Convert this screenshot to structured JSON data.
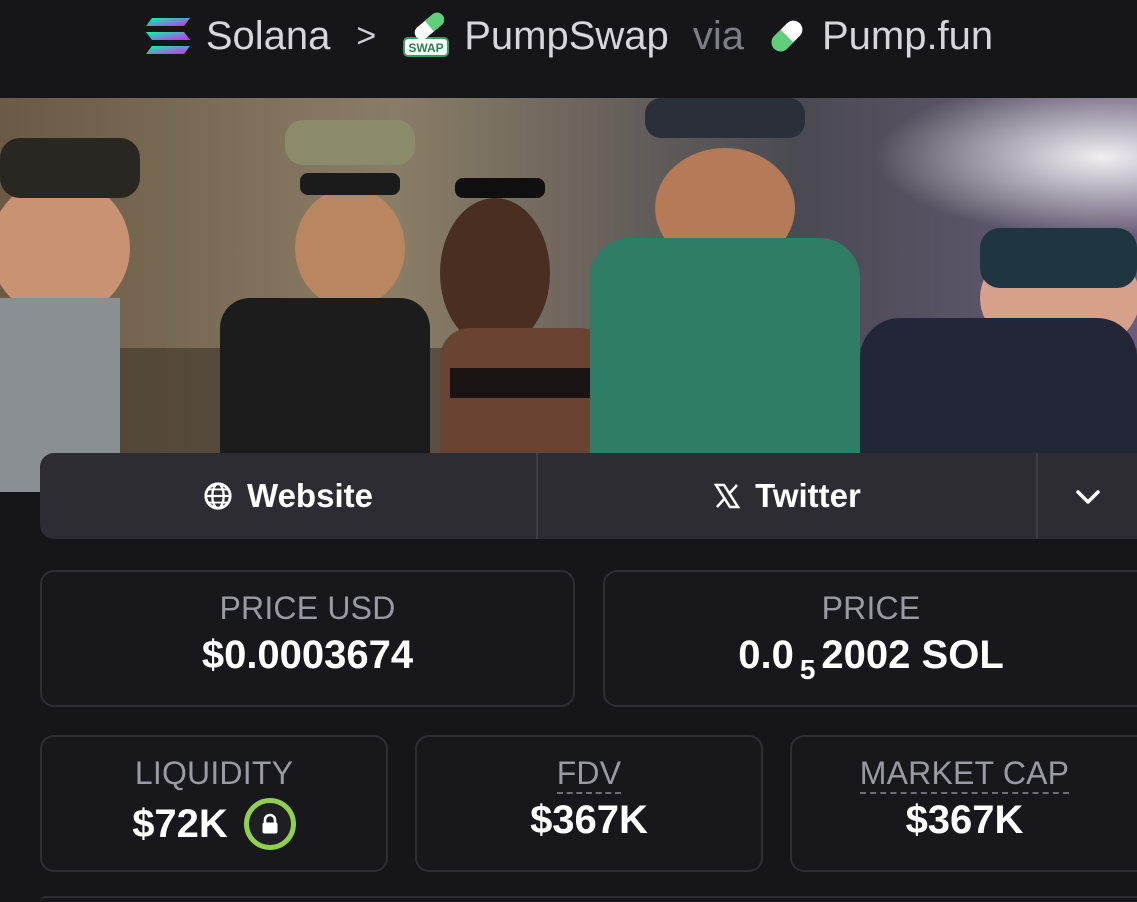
{
  "breadcrumb": {
    "chain": "Solana",
    "separator": ">",
    "dex": "PumpSwap",
    "dex_badge": "SWAP",
    "via": "via",
    "source": "Pump.fun",
    "icons": [
      "solana-icon",
      "chevron-right-icon",
      "pumpswap-icon",
      "pill-icon"
    ]
  },
  "banner": {
    "alt": "token banner image"
  },
  "links": {
    "website_label": "Website",
    "twitter_label": "Twitter",
    "icons": [
      "globe-icon",
      "x-icon",
      "chevron-down-icon"
    ]
  },
  "stats": {
    "price_usd": {
      "label": "PRICE USD",
      "value": "$0.0003674"
    },
    "price_native": {
      "label": "PRICE",
      "value_lead": "0.0",
      "value_zeros": "5",
      "value_tail": "2002 SOL"
    },
    "liquidity": {
      "label": "LIQUIDITY",
      "value": "$72K"
    },
    "fdv": {
      "label": "FDV",
      "value": "$367K"
    },
    "market_cap": {
      "label": "MARKET CAP",
      "value": "$367K"
    }
  },
  "colors": {
    "background": "#15151a",
    "card_border": "#2e2e35",
    "button_bg": "#2c2c32",
    "label_gray": "#9a9aa3",
    "lock_ring": "#8fd14f"
  }
}
